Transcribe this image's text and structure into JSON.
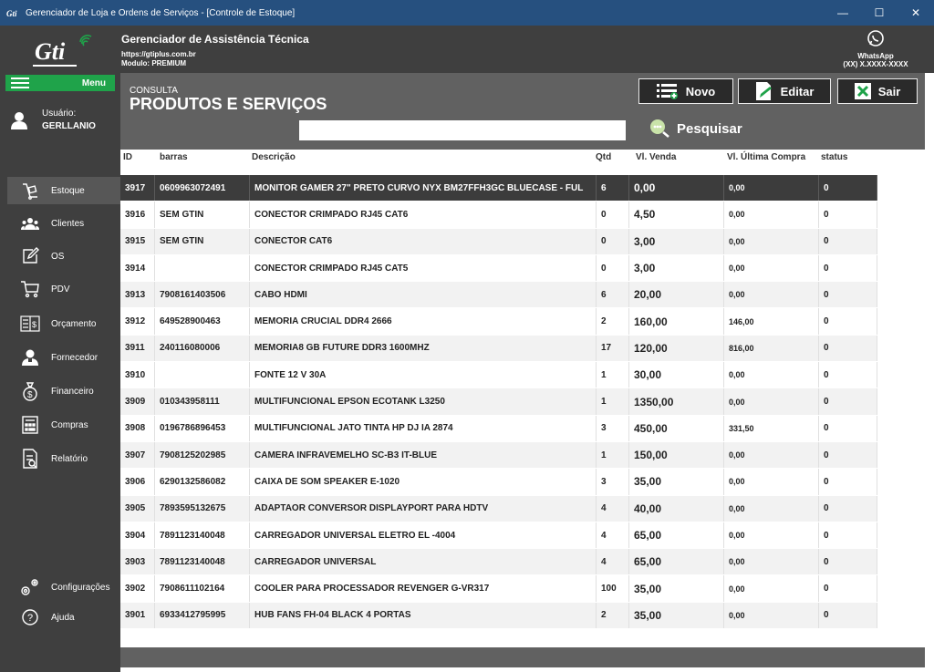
{
  "window": {
    "title": "Gerenciador de Loja e Ordens de Serviços - [Controle de Estoque]",
    "app_icon": "Gti",
    "controls": {
      "minimize": "—",
      "maximize": "☐",
      "close": "✕"
    }
  },
  "header": {
    "logo_text": "Gti",
    "title": "Gerenciador de Assistência Técnica",
    "url": "https://gtiplus.com.br",
    "module": "Modulo: PREMIUM",
    "whatsapp_label": "WhatsApp",
    "whatsapp_number": "(XX) X.XXXX-XXXX"
  },
  "sidebar": {
    "menu_label": "Menu",
    "user_label": "Usuário:",
    "user_name": "GERLLANIO",
    "items": [
      {
        "label": "Estoque",
        "icon": "box-icon",
        "active": true
      },
      {
        "label": "Clientes",
        "icon": "people-icon"
      },
      {
        "label": "OS",
        "icon": "edit-icon"
      },
      {
        "label": "PDV",
        "icon": "cart-icon"
      },
      {
        "label": "Orçamento",
        "icon": "invoice-icon"
      },
      {
        "label": "Fornecedor",
        "icon": "supplier-icon"
      },
      {
        "label": "Financeiro",
        "icon": "money-bag-icon"
      },
      {
        "label": "Compras",
        "icon": "calculator-icon"
      },
      {
        "label": "Relatório",
        "icon": "report-icon"
      }
    ],
    "bottom_items": [
      {
        "label": "Configurações",
        "icon": "gear-icon"
      },
      {
        "label": "Ajuda",
        "icon": "help-icon"
      }
    ]
  },
  "toolbar": {
    "subtitle": "CONSULTA",
    "title": "PRODUTOS E SERVIÇOS",
    "search_value": "",
    "search_label": "Pesquisar",
    "new_label": "Novo",
    "edit_label": "Editar",
    "exit_label": "Sair"
  },
  "table": {
    "columns": [
      "ID",
      "barras",
      "Descrição",
      "Qtd",
      "Vl. Venda",
      "Vl. Última Compra",
      "status"
    ],
    "rows": [
      [
        "3917",
        "0609963072491",
        "MONITOR GAMER 27\" PRETO CURVO NYX BM27FFH3GC BLUECASE - FUL",
        "6",
        "0,00",
        "0,00",
        "0"
      ],
      [
        "3916",
        "SEM GTIN",
        "CONECTOR CRIMPADO RJ45 CAT6",
        "0",
        "4,50",
        "0,00",
        "0"
      ],
      [
        "3915",
        "SEM GTIN",
        "CONECTOR CAT6",
        "0",
        "3,00",
        "0,00",
        "0"
      ],
      [
        "3914",
        "",
        "CONECTOR CRIMPADO RJ45 CAT5",
        "0",
        "3,00",
        "0,00",
        "0"
      ],
      [
        "3913",
        "7908161403506",
        "CABO HDMI",
        "6",
        "20,00",
        "0,00",
        "0"
      ],
      [
        "3912",
        "649528900463",
        "MEMORIA CRUCIAL DDR4 2666",
        "2",
        "160,00",
        "146,00",
        "0"
      ],
      [
        "3911",
        "240116080006",
        "MEMORIA8 GB FUTURE DDR3 1600MHZ",
        "17",
        "120,00",
        "816,00",
        "0"
      ],
      [
        "3910",
        "",
        "FONTE 12 V 30A",
        "1",
        "30,00",
        "0,00",
        "0"
      ],
      [
        "3909",
        "010343958111",
        "MULTIFUNCIONAL EPSON ECOTANK L3250",
        "1",
        "1350,00",
        "0,00",
        "0"
      ],
      [
        "3908",
        "0196786896453",
        "MULTIFUNCIONAL JATO TINTA HP DJ IA 2874",
        "3",
        "450,00",
        "331,50",
        "0"
      ],
      [
        "3907",
        "7908125202985",
        "CAMERA INFRAVEMELHO SC-B3 IT-BLUE",
        "1",
        "150,00",
        "0,00",
        "0"
      ],
      [
        "3906",
        "6290132586082",
        "CAIXA DE SOM SPEAKER E-1020",
        "3",
        "35,00",
        "0,00",
        "0"
      ],
      [
        "3905",
        "7893595132675",
        "ADAPTAOR CONVERSOR DISPLAYPORT PARA HDTV",
        "4",
        "40,00",
        "0,00",
        "0"
      ],
      [
        "3904",
        "7891123140048",
        "CARREGADOR UNIVERSAL ELETRO EL -4004",
        "4",
        "65,00",
        "0,00",
        "0"
      ],
      [
        "3903",
        "7891123140048",
        "CARREGADOR UNIVERSAL",
        "4",
        "65,00",
        "0,00",
        "0"
      ],
      [
        "3902",
        "7908611102164",
        "COOLER PARA PROCESSADOR REVENGER G-VR317",
        "100",
        "35,00",
        "0,00",
        "0"
      ],
      [
        "3901",
        "6933412795995",
        "HUB FANS FH-04 BLACK 4 PORTAS",
        "2",
        "35,00",
        "0,00",
        "0"
      ]
    ]
  },
  "colors": {
    "titlebar": "#26507f",
    "dark": "#3f3f3f",
    "band": "#616161",
    "menu_green": "#1fa34a",
    "selected_row": "#3c3c3c"
  }
}
